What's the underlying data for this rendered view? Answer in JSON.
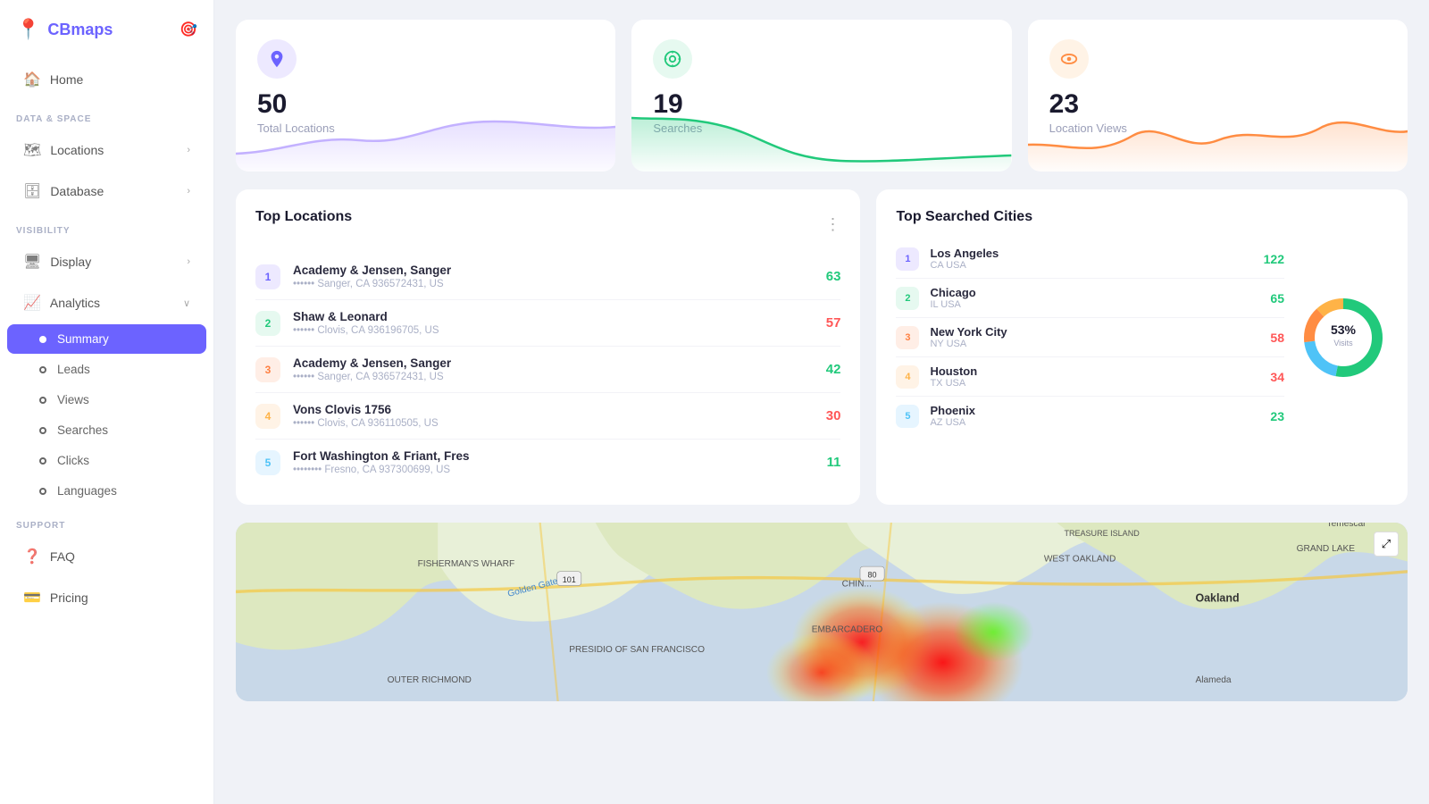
{
  "app": {
    "logo_text": "CBmaps",
    "logo_icon": "📍"
  },
  "sidebar": {
    "nav_items": [
      {
        "id": "home",
        "label": "Home",
        "icon": "🏠",
        "active": false
      }
    ],
    "sections": [
      {
        "label": "Data & Space",
        "items": [
          {
            "id": "locations",
            "label": "Locations",
            "icon": "🗺",
            "has_chevron": true
          },
          {
            "id": "database",
            "label": "Database",
            "icon": "🗄",
            "has_chevron": true
          }
        ]
      },
      {
        "label": "Visibility",
        "items": [
          {
            "id": "display",
            "label": "Display",
            "icon": "🖥",
            "has_chevron": true
          },
          {
            "id": "analytics",
            "label": "Analytics",
            "icon": "📈",
            "has_chevron": true,
            "expanded": true
          }
        ]
      }
    ],
    "analytics_subnav": [
      {
        "id": "summary",
        "label": "Summary",
        "active": true
      },
      {
        "id": "leads",
        "label": "Leads",
        "active": false
      },
      {
        "id": "views",
        "label": "Views",
        "active": false
      },
      {
        "id": "searches",
        "label": "Searches",
        "active": false
      },
      {
        "id": "clicks",
        "label": "Clicks",
        "active": false
      },
      {
        "id": "languages",
        "label": "Languages",
        "active": false
      }
    ],
    "support_section": {
      "label": "Support",
      "items": [
        {
          "id": "faq",
          "label": "FAQ",
          "icon": "❓"
        },
        {
          "id": "pricing",
          "label": "Pricing",
          "icon": "💳"
        }
      ]
    }
  },
  "stats": [
    {
      "id": "total-locations",
      "number": "50",
      "label": "Total Locations",
      "icon_color": "purple",
      "chart_color": "#c3b1ff"
    },
    {
      "id": "searches",
      "number": "19",
      "label": "Searches",
      "icon_color": "green",
      "chart_color": "#21c97b"
    },
    {
      "id": "location-views",
      "number": "23",
      "label": "Location Views",
      "icon_color": "orange",
      "chart_color": "#ff8c42"
    }
  ],
  "top_locations": {
    "title": "Top Locations",
    "items": [
      {
        "rank": 1,
        "name": "Academy & Jensen, Sanger",
        "addr": "•••••• Sanger, CA 936572431, US",
        "count": "63",
        "count_color": "green"
      },
      {
        "rank": 2,
        "name": "Shaw & Leonard",
        "addr": "•••••• Clovis, CA 936196705, US",
        "count": "57",
        "count_color": "red"
      },
      {
        "rank": 3,
        "name": "Academy & Jensen, Sanger",
        "addr": "•••••• Sanger, CA 936572431, US",
        "count": "42",
        "count_color": "green"
      },
      {
        "rank": 4,
        "name": "Vons Clovis 1756",
        "addr": "•••••• Clovis, CA 936110505, US",
        "count": "30",
        "count_color": "red"
      },
      {
        "rank": 5,
        "name": "Fort Washington & Friant, Fres",
        "addr": "•••••••• Fresno, CA 937300699, US",
        "count": "11",
        "count_color": "green"
      }
    ]
  },
  "top_cities": {
    "title": "Top Searched Cities",
    "items": [
      {
        "rank": 1,
        "name": "Los Angeles",
        "region": "CA USA",
        "count": "122",
        "count_color": "green",
        "rank_color": "purple"
      },
      {
        "rank": 2,
        "name": "Chicago",
        "region": "IL USA",
        "count": "65",
        "count_color": "green",
        "rank_color": "green"
      },
      {
        "rank": 3,
        "name": "New York City",
        "region": "NY USA",
        "count": "58",
        "count_color": "red",
        "rank_color": "orange"
      },
      {
        "rank": 4,
        "name": "Houston",
        "region": "TX USA",
        "count": "34",
        "count_color": "red",
        "rank_color": "yellow"
      },
      {
        "rank": 5,
        "name": "Phoenix",
        "region": "AZ USA",
        "count": "23",
        "count_color": "green",
        "rank_color": "blue"
      }
    ],
    "donut": {
      "percent": "53%",
      "label": "Visits"
    }
  }
}
